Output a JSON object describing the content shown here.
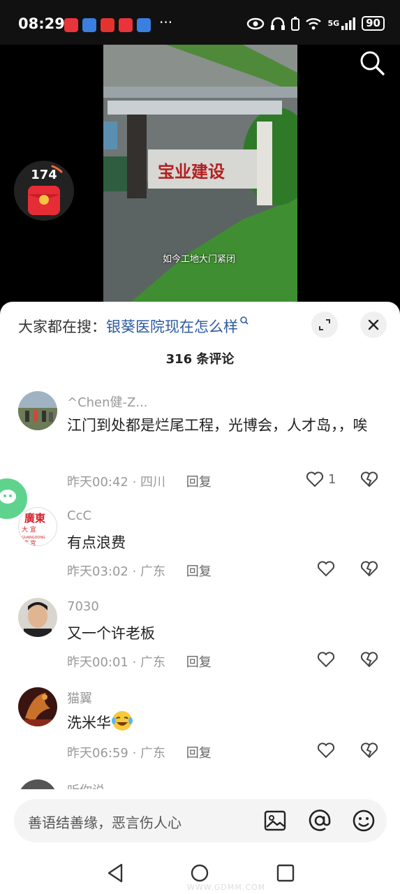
{
  "status": {
    "time": "08:29",
    "more": "···",
    "network": "5G",
    "battery": "90"
  },
  "video": {
    "caption": "如今工地大门紧闭",
    "gate_sign": "宝业建设",
    "redpacket_count": "174"
  },
  "panel": {
    "hot_search_label": "大家都在搜：",
    "hot_search_query": "银葵医院现在怎么样",
    "comments_count": "316 条评论"
  },
  "comments": [
    {
      "user": "^Chen健-Z...",
      "text": "江门到处都是烂尾工程，光博会，人才岛，，唉",
      "time": "昨天00:42",
      "location": "四川",
      "reply": "回复",
      "likes": "1"
    },
    {
      "user": "CcC",
      "text": "有点浪费",
      "time": "昨天03:02",
      "location": "广东",
      "reply": "回复",
      "likes": ""
    },
    {
      "user": "7030",
      "text": "又一个许老板",
      "time": "昨天00:01",
      "location": "广东",
      "reply": "回复",
      "likes": ""
    },
    {
      "user": "猫翼",
      "text": "洗米华",
      "time": "昨天06:59",
      "location": "广东",
      "reply": "回复",
      "likes": ""
    },
    {
      "user": "听你说"
    }
  ],
  "avatar2_text": {
    "a": "廣東",
    "b": "大 宜",
    "c": "GUANGDONG",
    "d": "宜 宜"
  },
  "input": {
    "placeholder": "善语结善缘，恶言伤人心"
  },
  "watermark": "WWW.GDMM.COM"
}
